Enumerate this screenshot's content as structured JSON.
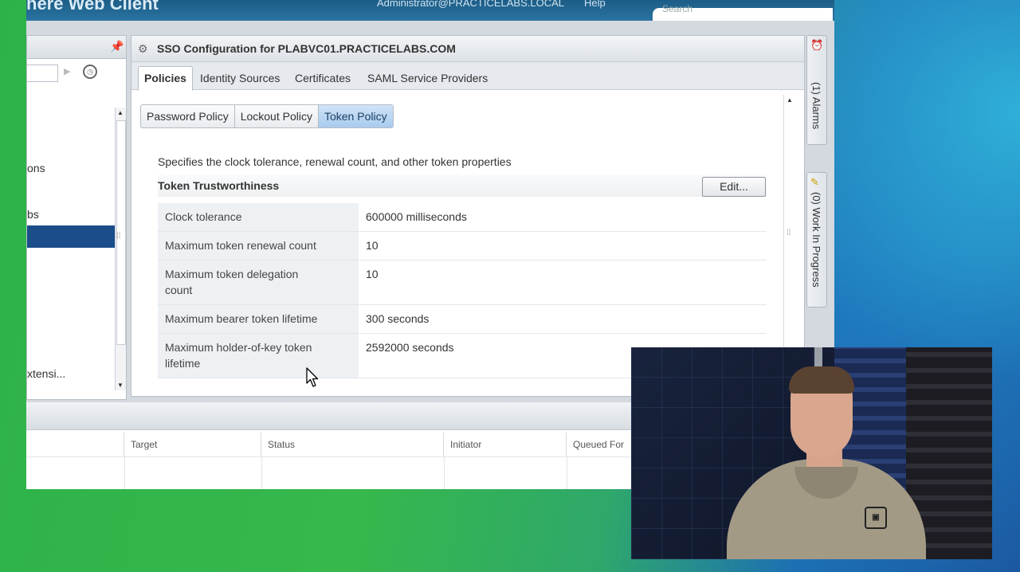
{
  "header": {
    "app_name": "here Web Client",
    "user": "Administrator@PRACTICELABS.LOCAL",
    "help": "Help",
    "search_placeholder": "Search"
  },
  "navigator": {
    "items": [
      {
        "label": ""
      },
      {
        "label": "ons"
      },
      {
        "label": ""
      },
      {
        "label": "bs"
      },
      {
        "label": ""
      },
      {
        "label": ""
      },
      {
        "label": ""
      },
      {
        "label": ""
      },
      {
        "label": ""
      },
      {
        "label": ""
      },
      {
        "label": "xtensi..."
      }
    ],
    "selected_index": 4
  },
  "panel": {
    "title": "SSO Configuration for PLABVC01.PRACTICELABS.COM",
    "tabs": [
      {
        "label": "Policies",
        "active": true
      },
      {
        "label": "Identity Sources",
        "active": false
      },
      {
        "label": "Certificates",
        "active": false
      },
      {
        "label": "SAML Service Providers",
        "active": false
      }
    ],
    "subtabs": [
      {
        "label": "Password Policy",
        "active": false
      },
      {
        "label": "Lockout Policy",
        "active": false
      },
      {
        "label": "Token Policy",
        "active": true
      }
    ],
    "description": "Specifies the clock tolerance, renewal count, and other token properties",
    "section_title": "Token Trustworthiness",
    "edit_label": "Edit...",
    "properties": [
      {
        "key": "Clock tolerance",
        "value": "600000 milliseconds"
      },
      {
        "key": "Maximum token renewal count",
        "value": "10"
      },
      {
        "key": "Maximum token delegation count",
        "value": "10"
      },
      {
        "key": "Maximum bearer token lifetime",
        "value": "300 seconds"
      },
      {
        "key": "Maximum holder-of-key token lifetime",
        "value": "2592000 seconds"
      }
    ]
  },
  "side_panel": {
    "alarms": "(1) Alarms",
    "work_in_progress": "(0) Work In Progress"
  },
  "tasks": {
    "columns": [
      "",
      "Target",
      "Status",
      "Initiator",
      "Queued For"
    ]
  },
  "icons": {
    "pin": "pin-icon",
    "history": "history-icon",
    "sso_config": "sso-config-icon",
    "alarm": "alarm-clock-icon",
    "work": "notepad-icon"
  },
  "colors": {
    "selection": "#1a4d8a",
    "active_subtab": "#a9cbee",
    "header": "#2a73a2"
  }
}
